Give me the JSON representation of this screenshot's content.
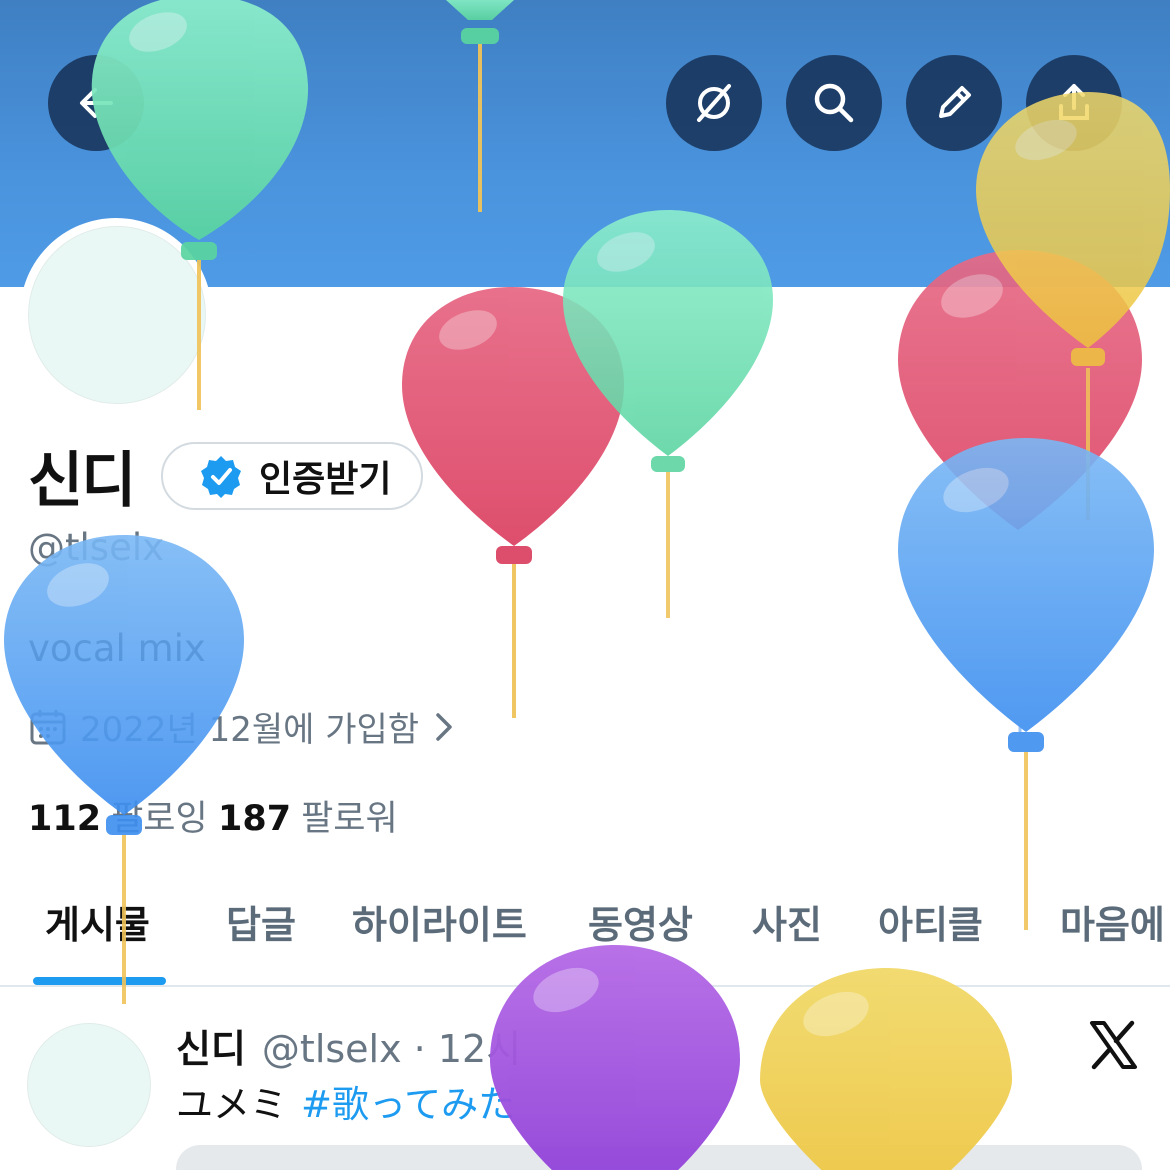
{
  "header": {
    "back_icon": "arrow-left-icon",
    "actions": [
      "grok-icon",
      "search-icon",
      "pencil-icon",
      "share-icon"
    ]
  },
  "profile": {
    "name": "신디",
    "verify_label": "인증받기",
    "handle": "@tlselx",
    "bio": "vocal mix",
    "joined": "2022년 12월에 가입함",
    "following_count": "112",
    "following_label": "팔로잉",
    "followers_count": "187",
    "followers_label": "팔로워"
  },
  "tabs": [
    {
      "label": "게시물",
      "active": true
    },
    {
      "label": "답글"
    },
    {
      "label": "하이라이트"
    },
    {
      "label": "동영상"
    },
    {
      "label": "사진"
    },
    {
      "label": "아티클"
    },
    {
      "label": "마음에"
    }
  ],
  "post": {
    "name": "신디",
    "meta": "@tlselx · 12시",
    "text": "ユメミ",
    "hashtag": "#歌ってみた"
  },
  "colors": {
    "banner": "#4a93dd",
    "accent": "#1d9bf0",
    "verified": "#1d9bf0"
  }
}
